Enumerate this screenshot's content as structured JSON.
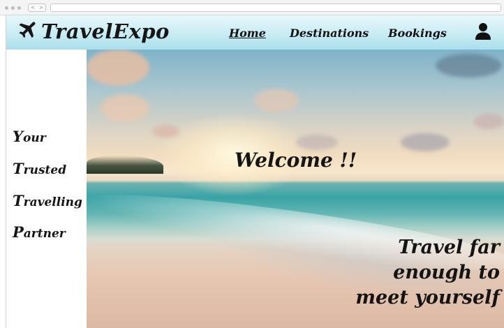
{
  "browser": {
    "nav_back_label": "<",
    "nav_forward_label": ">"
  },
  "header": {
    "brand_name": "TravelExpo",
    "brand_icon": "airplane-icon",
    "nav": {
      "home": "Home",
      "destinations": "Destinations",
      "bookings": "Bookings"
    },
    "active_nav": "Home",
    "user_icon": "user-icon"
  },
  "sidebar": {
    "tagline": [
      {
        "cap": "Y",
        "rest": "our"
      },
      {
        "cap": "T",
        "rest": "rusted"
      },
      {
        "cap": "T",
        "rest": "ravelling"
      },
      {
        "cap": "P",
        "rest": "artner"
      }
    ]
  },
  "hero": {
    "image": "beach-sunset-photo",
    "welcome": "Welcome !!",
    "quote_lines": [
      "Travel far",
      "enough to",
      "meet yourself"
    ]
  },
  "colors": {
    "header_gradient_top": "#e6f7fb",
    "header_gradient_bottom": "#a9dfec",
    "text": "#141414"
  }
}
